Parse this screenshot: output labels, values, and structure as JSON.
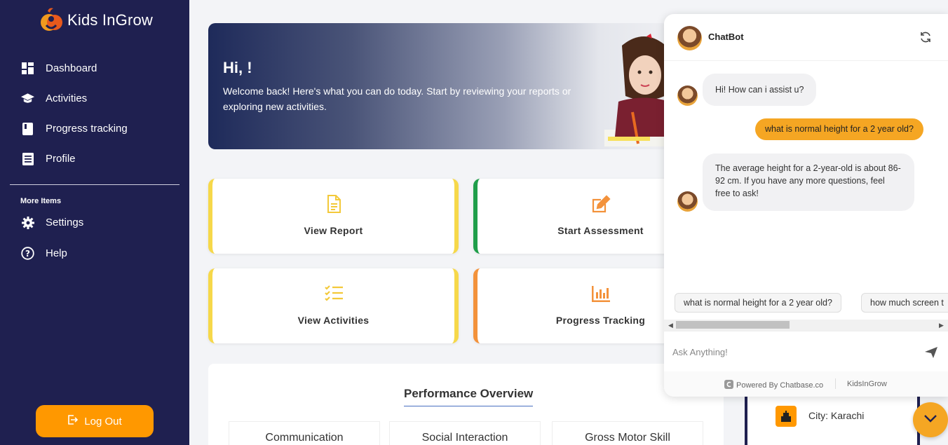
{
  "brand": {
    "name": "Kids InGrow",
    "accent": "#ff9800"
  },
  "sidebar": {
    "items": [
      {
        "label": "Dashboard",
        "icon": "dashboard-icon"
      },
      {
        "label": "Activities",
        "icon": "graduation-cap-icon"
      },
      {
        "label": "Progress tracking",
        "icon": "book-icon"
      },
      {
        "label": "Profile",
        "icon": "list-icon"
      }
    ],
    "more_label": "More Items",
    "more_items": [
      {
        "label": "Settings",
        "icon": "gear-icon"
      },
      {
        "label": "Help",
        "icon": "question-icon"
      }
    ],
    "logout_label": "Log Out",
    "background": "#1f2050"
  },
  "banner": {
    "title": "Hi, !",
    "text": "Welcome back! Here's what you can do today. Start by reviewing your reports or exploring new activities."
  },
  "cards": [
    {
      "label": "View Report",
      "icon": "document-icon",
      "border": "#f6d84a"
    },
    {
      "label": "Start Assessment",
      "icon": "edit-icon",
      "border": "#1f9e4a"
    },
    {
      "label": "View Activities",
      "icon": "checklist-icon",
      "border": "#f6d84a"
    },
    {
      "label": "Progress Tracking",
      "icon": "bar-chart-icon",
      "border": "#f3923b"
    }
  ],
  "performance": {
    "title": "Performance Overview",
    "tabs": [
      "Communication",
      "Social Interaction",
      "Gross Motor Skill"
    ]
  },
  "info": {
    "city": "City: Karachi"
  },
  "chat": {
    "title": "ChatBot",
    "messages": [
      {
        "role": "bot",
        "text": "Hi! How can i assist u?"
      },
      {
        "role": "user",
        "text": "what is normal height for a 2 year old?"
      },
      {
        "role": "bot",
        "text": "The average height for a 2-year-old is about 86-92 cm. If you have any more questions, feel free to ask!"
      }
    ],
    "suggestions": [
      "what is normal height for a 2 year old?",
      "how much screen t"
    ],
    "input_placeholder": "Ask Anything!",
    "powered_by": "Powered By Chatbase.co",
    "footer_brand": "KidsInGrow"
  }
}
